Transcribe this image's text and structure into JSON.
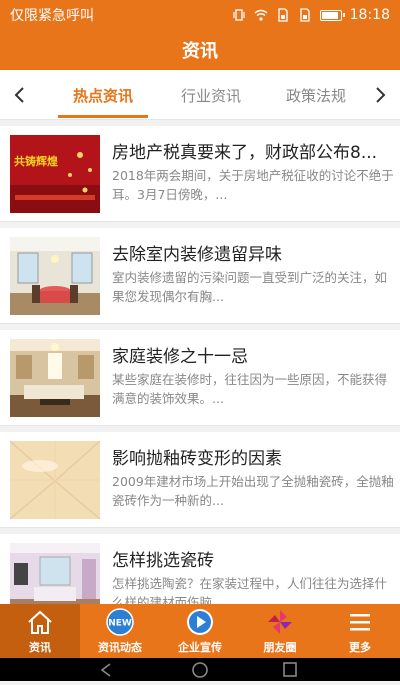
{
  "status_bar": {
    "carrier": "仅限紧急呼叫",
    "time": "18:18"
  },
  "header": {
    "title": "资讯"
  },
  "tabs": [
    {
      "label": "热点资讯",
      "active": true
    },
    {
      "label": "行业资讯",
      "active": false
    },
    {
      "label": "政策法规",
      "active": false
    }
  ],
  "news": [
    {
      "title": "房地产税真要来了，财政部公布8...",
      "desc": "2018年两会期间，关于房地产税征收的讨论不绝于耳。3月7日傍晚，...",
      "thumb_text": "共铸辉煌"
    },
    {
      "title": "去除室内装修遗留异味",
      "desc": "室内装修遗留的污染问题一直受到广泛的关注，如果您发现偶尔有胸..."
    },
    {
      "title": "家庭装修之十一忌",
      "desc": "某些家庭在装修时，往往因为一些原因，不能获得满意的装饰效果。..."
    },
    {
      "title": "影响抛釉砖变形的因素",
      "desc": "2009年建材市场上开始出现了全抛釉瓷砖，全抛釉瓷砖作为一种新的..."
    },
    {
      "title": "怎样挑选瓷砖",
      "desc": "怎样挑选陶瓷？在家装过程中，人们往往为选择什么样的建材而伤脑..."
    }
  ],
  "bottom_nav": [
    {
      "label": "资讯",
      "icon": "home-icon",
      "active": true
    },
    {
      "label": "资讯动态",
      "icon": "new-badge-icon",
      "badge_text": "NEW"
    },
    {
      "label": "企业宣传",
      "icon": "play-icon"
    },
    {
      "label": "朋友圈",
      "icon": "pinwheel-icon"
    },
    {
      "label": "更多",
      "icon": "menu-icon"
    }
  ],
  "colors": {
    "accent": "#e8751a",
    "accent_dark": "#c45f0f"
  }
}
